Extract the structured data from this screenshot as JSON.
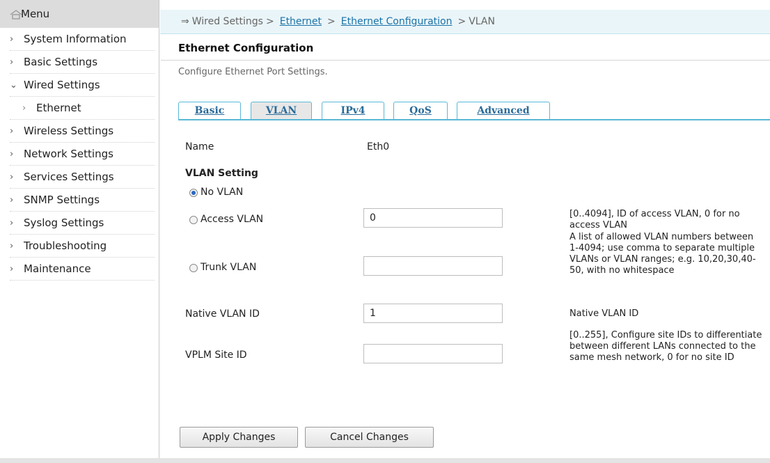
{
  "sidebar": {
    "title": "Menu",
    "items": [
      {
        "label": "System Information",
        "chevron": "›"
      },
      {
        "label": "Basic Settings",
        "chevron": "›"
      },
      {
        "label": "Wired Settings",
        "chevron": "⌄"
      },
      {
        "label": "Ethernet",
        "chevron": "›"
      },
      {
        "label": "Wireless Settings",
        "chevron": "›"
      },
      {
        "label": "Network Settings",
        "chevron": "›"
      },
      {
        "label": "Services Settings",
        "chevron": "›"
      },
      {
        "label": "SNMP Settings",
        "chevron": "›"
      },
      {
        "label": "Syslog Settings",
        "chevron": "›"
      },
      {
        "label": "Troubleshooting",
        "chevron": "›"
      },
      {
        "label": "Maintenance",
        "chevron": "›"
      }
    ]
  },
  "breadcrumb": {
    "arrow": "⇒",
    "root": "Wired Settings",
    "sep": ">",
    "link1": "Ethernet",
    "link2": "Ethernet Configuration",
    "current": "VLAN"
  },
  "page": {
    "title": "Ethernet Configuration",
    "subtitle": "Configure Ethernet Port Settings."
  },
  "tabs": [
    "Basic",
    "VLAN",
    "IPv4",
    "QoS",
    "Advanced"
  ],
  "active_tab": "VLAN",
  "form": {
    "name_label": "Name",
    "name_value": "Eth0",
    "vlan_setting_label": "VLAN Setting",
    "no_vlan_label": "No VLAN",
    "access_vlan_label": "Access VLAN",
    "access_vlan_value": "0",
    "access_vlan_help": "[0..4094], ID of access VLAN, 0 for no access VLAN",
    "trunk_vlan_label": "Trunk VLAN",
    "trunk_vlan_value": "",
    "trunk_vlan_help": "A list of allowed VLAN numbers between 1-4094; use comma to separate multiple VLANs or VLAN ranges; e.g. 10,20,30,40-50, with no whitespace",
    "native_vlan_label": "Native VLAN ID",
    "native_vlan_value": "1",
    "native_vlan_help": "Native VLAN ID",
    "vplm_label": "VPLM Site ID",
    "vplm_value": "",
    "vplm_help": "[0..255], Configure site IDs to differentiate between different LANs connected to the same mesh network, 0 for no site ID",
    "selected_vlan_mode": "No VLAN"
  },
  "buttons": {
    "apply": "Apply Changes",
    "cancel": "Cancel Changes"
  },
  "colors": {
    "accent": "#59b8d6",
    "link": "#1a73a8",
    "crumb_bg": "#eaf5f9",
    "menu_bg": "#dcdcdc"
  }
}
